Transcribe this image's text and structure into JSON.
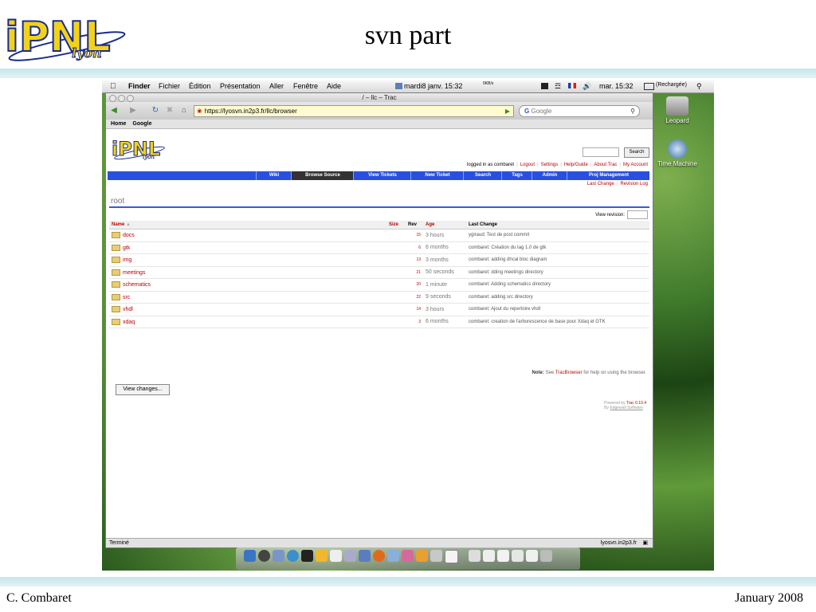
{
  "slide": {
    "title": "svn part",
    "footer_left": "C. Combaret",
    "footer_right": "January 2008"
  },
  "menubar": {
    "apple_icon": "apple-icon",
    "items": [
      "Finder",
      "Fichier",
      "Édition",
      "Présentation",
      "Aller",
      "Fenêtre",
      "Aide"
    ],
    "date": "mardi8 janv. 15:32",
    "clock": "mar. 15:32",
    "battery": "(Rechargée)",
    "net_speed": "0KB/s"
  },
  "desktop": {
    "icons": [
      {
        "label": "Leopard"
      },
      {
        "label": "Time Machine"
      }
    ]
  },
  "browser": {
    "title": "/ – llc – Trac",
    "url": "https://lyosvn.in2p3.fr/llc/browser",
    "search_placeholder": "Google",
    "bookmarks": [
      "Home",
      "Google"
    ],
    "status": "Terminé",
    "status_host": "lyosvn.in2p3.fr"
  },
  "trac": {
    "search_button": "Search",
    "metanav": [
      {
        "label": "logged in as combaret",
        "link": false
      },
      {
        "label": "Logout",
        "link": true
      },
      {
        "label": "Settings",
        "link": true
      },
      {
        "label": "Help/Guide",
        "link": true
      },
      {
        "label": "About Trac",
        "link": true
      },
      {
        "label": "My Account",
        "link": true
      }
    ],
    "mainnav": [
      "Wiki",
      "Browse Source",
      "View Tickets",
      "New Ticket",
      "Search",
      "Tags",
      "Admin",
      "Proj Management"
    ],
    "ctxtnav": [
      "Last Change",
      "Revision Log"
    ],
    "path": "root",
    "view_revision_label": "View revision:",
    "columns": [
      "Name",
      "Size",
      "Rev",
      "Age",
      "Last Change"
    ],
    "rows": [
      {
        "name": "docs",
        "rev": "15",
        "age": "3 hours",
        "change": "ygiraud: Test de post commit"
      },
      {
        "name": "gtk",
        "rev": "6",
        "age": "6 months",
        "change": "combaret: Création du tag 1.0 de gtk"
      },
      {
        "name": "img",
        "rev": "13",
        "age": "3 months",
        "change": "combaret: adding dhcal bloc diagram"
      },
      {
        "name": "meetings",
        "rev": "21",
        "age": "50 seconds",
        "change": "combaret: dding meetings directory"
      },
      {
        "name": "schematics",
        "rev": "20",
        "age": "1 minute",
        "change": "combaret: Adding schematics directory"
      },
      {
        "name": "src",
        "rev": "22",
        "age": "9 seconds",
        "change": "combaret: adding src directory"
      },
      {
        "name": "vhdl",
        "rev": "14",
        "age": "3 hours",
        "change": "combaret: Ajout du repertoire vhdl"
      },
      {
        "name": "xdaq",
        "rev": "3",
        "age": "6 months",
        "change": "combaret: creation de l'arborescence de base pour Xdaq et GTK"
      }
    ],
    "note_label": "Note:",
    "note_pre": "See",
    "note_link": "TracBrowser",
    "note_post": "for help on using the browser.",
    "view_changes_button": "View changes...",
    "powered_by": "Powered by",
    "powered_trac": "Trac 0.10.4",
    "powered_by2": "By",
    "powered_vendor": "Edgewall Software"
  },
  "colors": {
    "mainnav_blue": "#2a4fe0",
    "link_red": "#bb0000",
    "band": "#c6e6ec"
  }
}
